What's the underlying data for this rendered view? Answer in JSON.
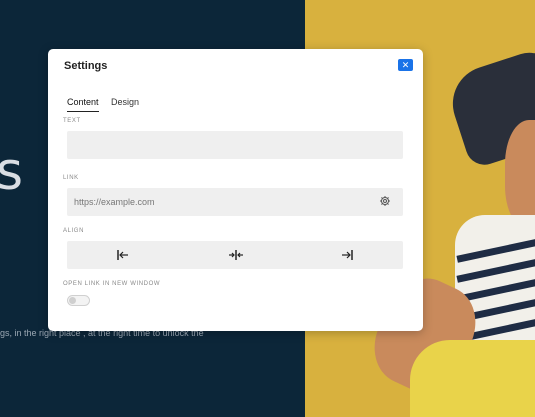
{
  "background": {
    "hero_text": "s P",
    "hero_subtext": "gs, in the right place , at the right time to unlock the"
  },
  "modal": {
    "title": "Settings",
    "close_icon": "close-icon",
    "tabs": [
      {
        "label": "Content",
        "active": true
      },
      {
        "label": "Design",
        "active": false
      }
    ],
    "text_field": {
      "label": "TEXT",
      "value": "",
      "placeholder": ""
    },
    "link_field": {
      "label": "LINK",
      "value": "",
      "placeholder": "https://example.com",
      "icon": "gear-icon"
    },
    "align": {
      "label": "ALIGN",
      "options": [
        {
          "name": "align-left",
          "icon": "align-left-icon"
        },
        {
          "name": "align-center",
          "icon": "align-center-icon"
        },
        {
          "name": "align-right",
          "icon": "align-right-icon"
        }
      ]
    },
    "new_window": {
      "label": "OPEN LINK IN NEW WINDOW",
      "checked": false
    }
  },
  "colors": {
    "accent": "#1a73e8",
    "background_dark": "#0c2639",
    "background_yellow": "#d8b13e"
  }
}
